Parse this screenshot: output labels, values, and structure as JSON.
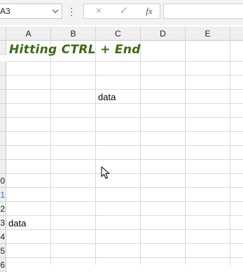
{
  "formula_bar": {
    "name_box": "A3",
    "cancel_icon": "×",
    "enter_icon": "✓",
    "fx_label": "fx",
    "formula": ""
  },
  "columns": [
    "A",
    "B",
    "C",
    "D",
    "E"
  ],
  "rows": [
    {
      "label": ""
    },
    {
      "label": ""
    },
    {
      "label": ""
    },
    {
      "label": ""
    },
    {
      "label": ""
    },
    {
      "label": ""
    },
    {
      "label": ""
    },
    {
      "label": ""
    },
    {
      "label": ""
    },
    {
      "label": "0"
    },
    {
      "label": "1"
    },
    {
      "label": "2"
    },
    {
      "label": "3"
    },
    {
      "label": "4"
    },
    {
      "label": "5"
    },
    {
      "label": "6"
    }
  ],
  "cells": {
    "title": "Hitting CTRL + End",
    "c4": "data",
    "a13": "data"
  },
  "colors": {
    "title": "#3a6b12",
    "row_highlight": "#2e75b6"
  }
}
